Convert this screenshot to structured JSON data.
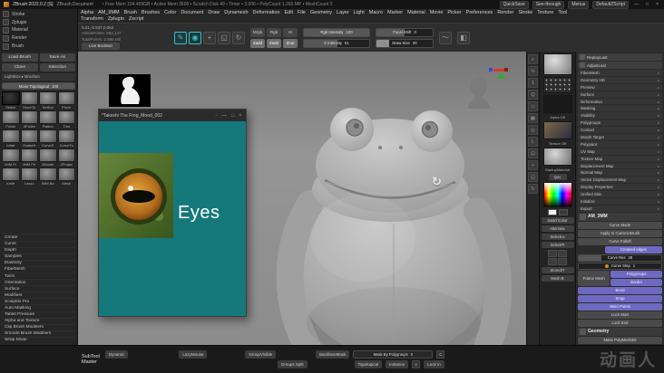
{
  "titlebar": {
    "app_title": "ZBrush 2022.0.2 [S]",
    "doc_title": "ZBrush Document",
    "stats": "• Free Mem 104.409GB • Active Mem 3606 • Scratch Disk 49 • Timer • 3.006 • PolyCount 1.266 MP • MeshCount 3",
    "buttons": [
      "QuickSave",
      "See-through",
      "Menus",
      "DefaultZScript"
    ],
    "window_controls": [
      "—",
      "□",
      "×"
    ]
  },
  "menubar": {
    "items": [
      "Alpha",
      "AM_9MM",
      "Brush",
      "Brushes",
      "Color",
      "Document",
      "Draw",
      "Dynamesh",
      "Deformation",
      "Edit",
      "File",
      "Geometry",
      "Layer",
      "Light",
      "Macro",
      "Marker",
      "Material",
      "Movie",
      "Picker",
      "Preferences",
      "Render",
      "Stroke",
      "Texture",
      "Tool",
      "Transform",
      "Zplugin",
      "Zscript"
    ]
  },
  "palette_tabs": [
    {
      "name": "palette-tab-stroke",
      "label": "Stroke"
    },
    {
      "name": "palette-tab-zplugin",
      "label": "Zplugin"
    },
    {
      "name": "palette-tab-material",
      "label": "Material"
    },
    {
      "name": "palette-tab-render",
      "label": "Render"
    },
    {
      "name": "palette-tab-brush",
      "label": "Brush"
    }
  ],
  "shelf": {
    "coords": "0.21,-0.537,0.062",
    "active_points": "ActivePoints: 582,147",
    "total_points": "TotalPoints: 2.895 Mil",
    "live_boolean": "Live Boolean",
    "edit_icons": [
      {
        "name": "edit-object-icon",
        "glyph": "✎"
      },
      {
        "name": "draw-icon",
        "glyph": "◉"
      },
      {
        "name": "move-icon",
        "glyph": "+"
      },
      {
        "name": "scale-icon",
        "glyph": "◱"
      },
      {
        "name": "rotate-icon",
        "glyph": "↻"
      }
    ],
    "mode_buttons": [
      {
        "label": "Mrgb"
      },
      {
        "label": "Rgb"
      },
      {
        "label": "M"
      }
    ],
    "sculpt_buttons": [
      {
        "label": "Zadd"
      },
      {
        "label": "Zsub"
      },
      {
        "label": "Zcut"
      }
    ],
    "rgb_intensity": {
      "label": "Rgb Intensity",
      "value": "100"
    },
    "z_intensity": {
      "label": "Z Intensity",
      "value": "51"
    },
    "focal_shift": {
      "label": "Focal Shift",
      "value": "0"
    },
    "draw_size": {
      "label": "Draw Size",
      "value": "20"
    }
  },
  "left_panel": {
    "load_brush": "Load Brush",
    "save_as": "Save As",
    "clone": "Clone",
    "selection": "Selection",
    "lightbox": "LightBox ▸ Brushes",
    "current_brush": {
      "label": "Move Topological",
      "value": "100"
    },
    "brushes": [
      {
        "label": "Select"
      },
      {
        "label": "MoveTo"
      },
      {
        "label": "DelDot"
      },
      {
        "label": "Pinch"
      },
      {
        "label": "Polish"
      },
      {
        "label": "hPolish"
      },
      {
        "label": "Flatten"
      },
      {
        "label": "Trim"
      },
      {
        "label": "Inflat"
      },
      {
        "label": "SnakeH"
      },
      {
        "label": "CurveS"
      },
      {
        "label": "CurveTu"
      },
      {
        "label": "IMM Pr"
      },
      {
        "label": "IMM Pri"
      },
      {
        "label": "ZModel"
      },
      {
        "label": "ZProjec"
      },
      {
        "label": "Knife"
      },
      {
        "label": "Lasso"
      },
      {
        "label": "IMM Ba"
      },
      {
        "label": "Mesh"
      }
    ],
    "sections": [
      {
        "label": "Create"
      },
      {
        "label": "Curve"
      },
      {
        "label": "Depth"
      },
      {
        "label": "Samples"
      },
      {
        "label": "Elasticity"
      },
      {
        "label": "FiberMesh"
      },
      {
        "label": "Twist"
      },
      {
        "label": "Orientation"
      },
      {
        "label": "Surface"
      },
      {
        "label": "Modifiers"
      },
      {
        "label": "Sculptris Pro"
      },
      {
        "label": "Auto Masking"
      },
      {
        "label": "Tablet Pressure"
      },
      {
        "label": "Alpha and Texture"
      },
      {
        "label": "Clip Brush Modifiers"
      },
      {
        "label": "Smooth Brush Modifiers"
      },
      {
        "label": "Wrap Mode"
      }
    ]
  },
  "canvas": {
    "ref_window": {
      "title": "*Takeshi The Frog_Mood_002",
      "caption": "Eyes",
      "controls": [
        "◦",
        "—",
        "□",
        "×"
      ]
    },
    "rotate_glyph": "↻"
  },
  "view_icons": [
    {
      "name": "bpr-render-icon",
      "glyph": "◐"
    },
    {
      "name": "aa-half-icon",
      "glyph": "½"
    },
    {
      "name": "actual-size-icon",
      "glyph": "1"
    },
    {
      "name": "zoom-icon",
      "glyph": "Q"
    },
    {
      "name": "persp-icon",
      "glyph": "◇"
    },
    {
      "name": "floor-grid-icon",
      "glyph": "▦"
    },
    {
      "name": "local-transform-icon",
      "glyph": "◎"
    },
    {
      "name": "lsym-icon",
      "glyph": "L"
    },
    {
      "name": "frame-icon",
      "glyph": "⊡"
    },
    {
      "name": "move-canvas-icon",
      "glyph": "+"
    },
    {
      "name": "scale-canvas-icon",
      "glyph": "◱"
    },
    {
      "name": "rotate-canvas-icon",
      "glyph": "↻"
    }
  ],
  "right_shelf": {
    "alpha_label": "Alpha Off",
    "texture_label": "Texture Off",
    "material_label": "StartupMaterial",
    "quv": "Quv",
    "switch_color": "SwitchColor",
    "alternate": "Alternate",
    "select_ls": "SelectLs",
    "select_pt": "SelectPt",
    "stored": "StoredIT",
    "mesh": "Mesh B"
  },
  "tool_panel": {
    "replay_last": "ReplayLast",
    "adjust_last": "AdjustLast",
    "sections": [
      {
        "label": "FiberMesh"
      },
      {
        "label": "Geometry HD"
      },
      {
        "label": "Preview"
      },
      {
        "label": "Surface"
      },
      {
        "label": "Deformation"
      },
      {
        "label": "Masking"
      },
      {
        "label": "Visibility"
      },
      {
        "label": "Polygroups"
      },
      {
        "label": "Contact"
      },
      {
        "label": "Morph Target"
      },
      {
        "label": "Polypaint"
      },
      {
        "label": "UV Map"
      },
      {
        "label": "Texture Map"
      },
      {
        "label": "Displacement Map"
      },
      {
        "label": "Normal Map"
      },
      {
        "label": "Vector Displacement Map"
      },
      {
        "label": "Display Properties"
      },
      {
        "label": "Unified Skin"
      },
      {
        "label": "Initialize"
      },
      {
        "label": "Export"
      }
    ],
    "custom_header": "AM_3MM",
    "curve_mode": "Curve Mode",
    "apply": "Apply to Current Brush",
    "falloff": "Curve Falloff",
    "creased": "Creased edges",
    "curve_res": {
      "label": "Curve Res",
      "value": "28"
    },
    "curve_step": {
      "label": "Curve Step",
      "value": "1"
    },
    "frame_mesh": "Frame Mesh",
    "polygroups": "Polygroups",
    "border": "Border",
    "bend": "Bend",
    "snap": "Snap",
    "weld": "Weld Points",
    "lock_start": "Lock Start",
    "lock_end": "Lock End",
    "geometry_header": "Geometry",
    "make_polymesh": "Make PolyMesh3D"
  },
  "bottombar": {
    "plugin_line1": "SubTool",
    "plugin_line2": "Master",
    "dynamic": "Dynamic",
    "lazymouse": "LazyMouse",
    "group_visible": "GroupVisible",
    "backface_mask": "BackfaceMask",
    "mask_slider": {
      "label": "Mask By Polygroups",
      "value": "0"
    },
    "c_box": "C",
    "groups_split": "Groups Split",
    "topological": "Topological",
    "instance": "Instance",
    "num": "2",
    "lock_in": "Lock In"
  },
  "watermark": "动画人",
  "colors": {
    "accent_teal": "#35c3cb",
    "accent_purple": "#6e69c0",
    "accent_orange": "#d98a2b",
    "ref_teal": "#15797c"
  }
}
